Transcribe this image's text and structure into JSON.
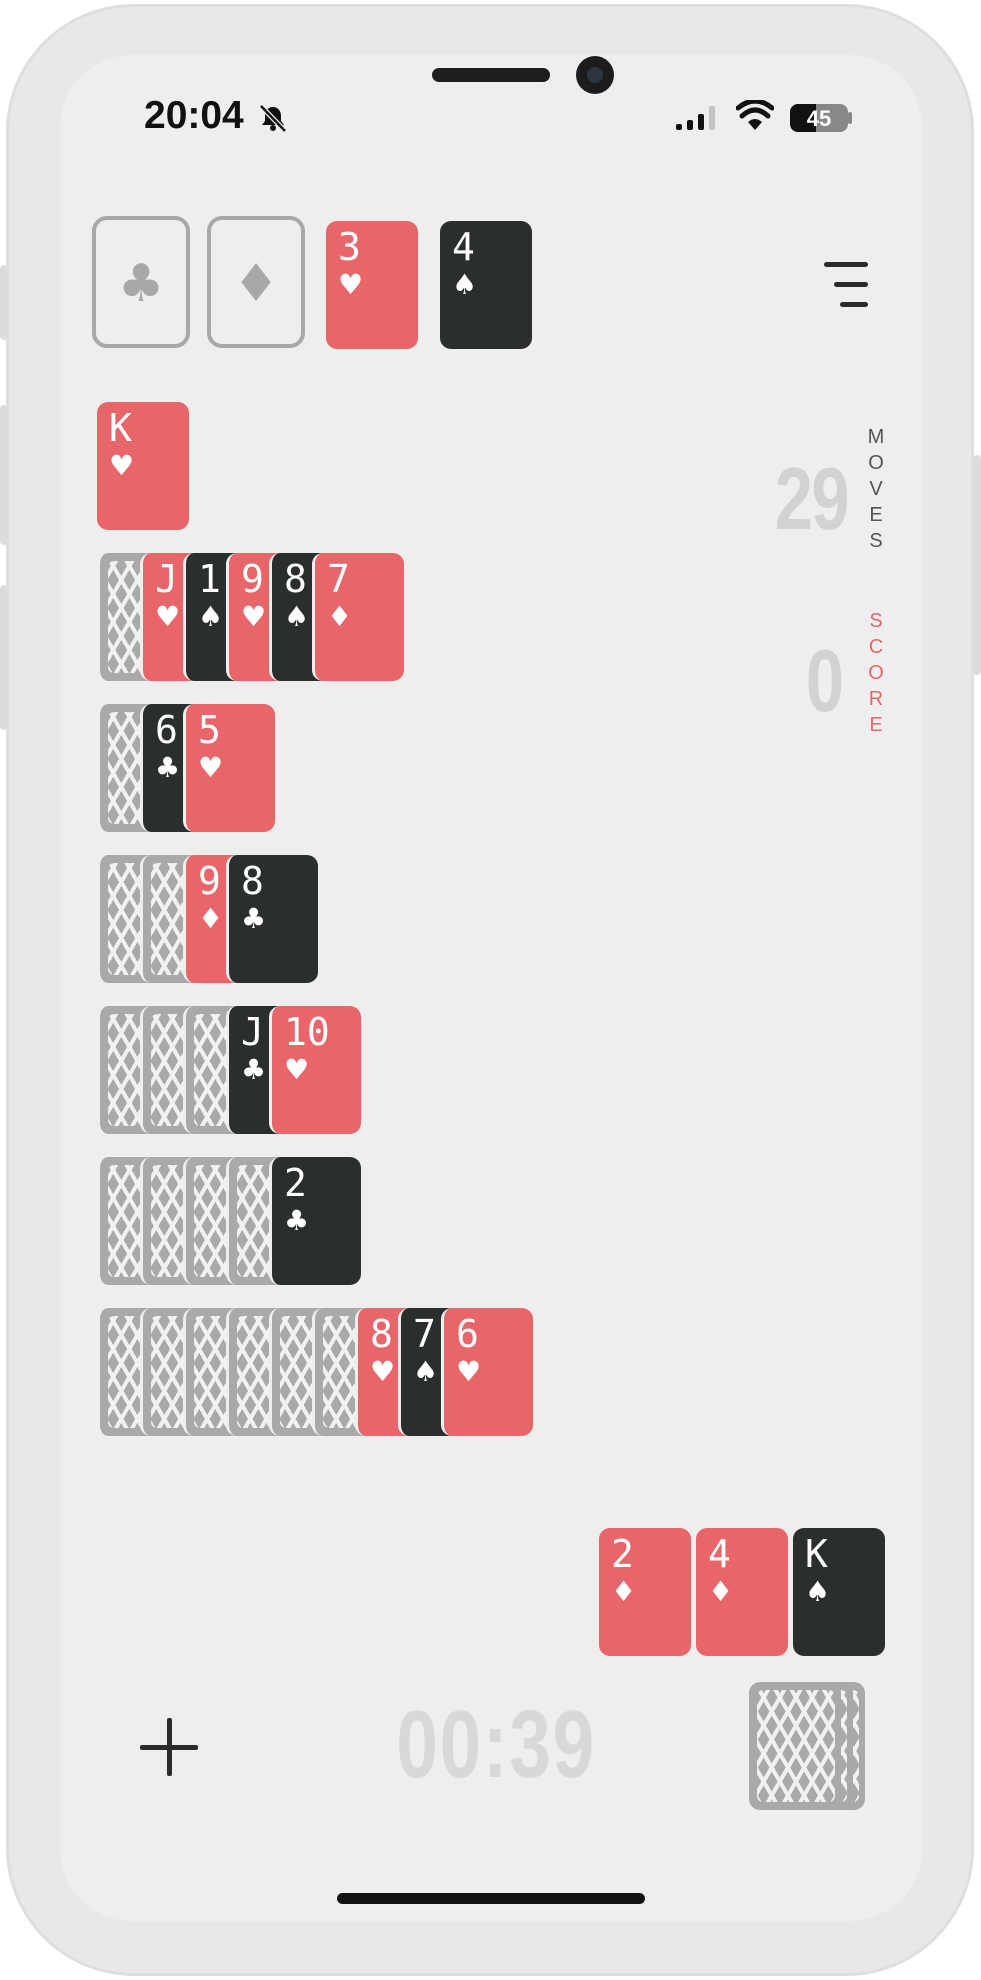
{
  "status_bar": {
    "time": "20:04",
    "battery": "45",
    "battery_level": 0.45
  },
  "foundation": {
    "slots": [
      {
        "suit_symbol": "♣",
        "icon": "club-icon",
        "empty": true
      },
      {
        "suit_symbol": "♦",
        "icon": "diamond-icon",
        "empty": true
      },
      {
        "rank": "3",
        "suit_symbol": "♥",
        "color": "red"
      },
      {
        "rank": "4",
        "suit_symbol": "♠",
        "color": "black"
      }
    ]
  },
  "menu": {
    "icon": "menu-icon"
  },
  "stats": {
    "moves_value": "29",
    "moves_label": "MOVES",
    "score_value": "0",
    "score_label": "SCORE",
    "moves_label_color": "#555555",
    "score_label_color": "#e8666a"
  },
  "tableau": [
    {
      "hidden": 0,
      "cards": [
        {
          "rank": "K",
          "suit": "♥",
          "color": "red"
        }
      ]
    },
    {
      "hidden": 1,
      "cards": [
        {
          "rank": "J",
          "suit": "♥",
          "color": "red"
        },
        {
          "rank": "1",
          "suit": "♠",
          "color": "black"
        },
        {
          "rank": "9",
          "suit": "♥",
          "color": "red"
        },
        {
          "rank": "8",
          "suit": "♠",
          "color": "black"
        },
        {
          "rank": "7",
          "suit": "♦",
          "color": "red"
        }
      ]
    },
    {
      "hidden": 1,
      "cards": [
        {
          "rank": "6",
          "suit": "♣",
          "color": "black"
        },
        {
          "rank": "5",
          "suit": "♥",
          "color": "red"
        }
      ]
    },
    {
      "hidden": 2,
      "cards": [
        {
          "rank": "9",
          "suit": "♦",
          "color": "red"
        },
        {
          "rank": "8",
          "suit": "♣",
          "color": "black"
        }
      ]
    },
    {
      "hidden": 3,
      "cards": [
        {
          "rank": "J",
          "suit": "♣",
          "color": "black"
        },
        {
          "rank": "10",
          "suit": "♥",
          "color": "red"
        }
      ]
    },
    {
      "hidden": 4,
      "cards": [
        {
          "rank": "2",
          "suit": "♣",
          "color": "black"
        }
      ]
    },
    {
      "hidden": 6,
      "cards": [
        {
          "rank": "8",
          "suit": "♥",
          "color": "red"
        },
        {
          "rank": "7",
          "suit": "♠",
          "color": "black"
        },
        {
          "rank": "6",
          "suit": "♥",
          "color": "red"
        }
      ]
    }
  ],
  "waste": [
    {
      "rank": "2",
      "suit": "♦",
      "color": "red"
    },
    {
      "rank": "4",
      "suit": "♦",
      "color": "red"
    },
    {
      "rank": "K",
      "suit": "♠",
      "color": "black"
    }
  ],
  "stock": {
    "backs": 3
  },
  "timer": "00:39",
  "new_game": {
    "icon": "plus-icon"
  },
  "colors": {
    "red": "#e8666a",
    "black": "#2a2f2e",
    "slot_border": "#a8a8a8",
    "background": "#efeeef"
  }
}
